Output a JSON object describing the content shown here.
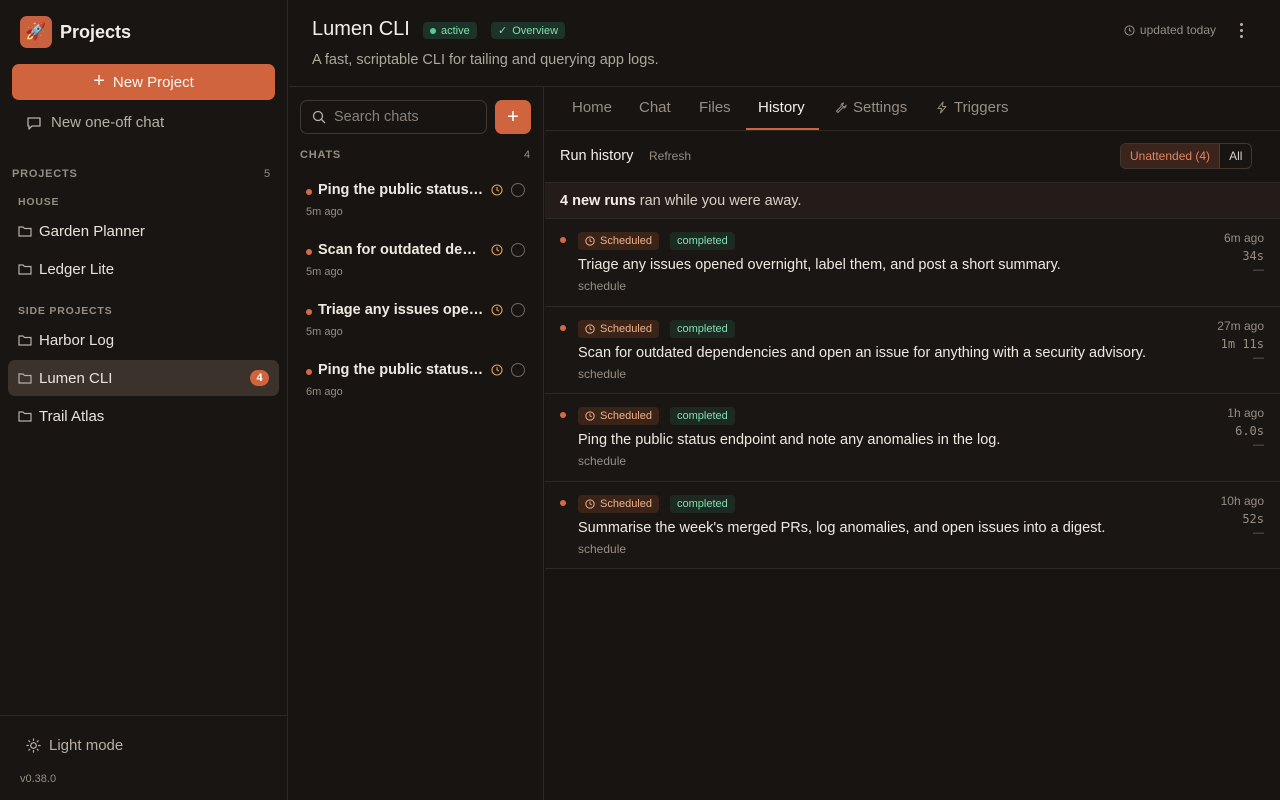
{
  "sidebar": {
    "title": "Projects",
    "new_project_label": "New Project",
    "new_chat_label": "New one-off chat",
    "projects_label": "PROJECTS",
    "projects_count": "5",
    "groups": [
      {
        "label": "HOUSE",
        "items": [
          "Garden Planner",
          "Ledger Lite"
        ]
      },
      {
        "label": "SIDE PROJECTS",
        "items": [
          "Harbor Log",
          "Lumen CLI",
          "Trail Atlas"
        ]
      }
    ],
    "active_project_badge": "4",
    "light_mode_label": "Light mode",
    "version": "v0.38.0"
  },
  "header": {
    "title": "Lumen CLI",
    "status": "active",
    "overview_label": "Overview",
    "subtitle": "A fast, scriptable CLI for tailing and querying app logs.",
    "updated": "updated today"
  },
  "chats": {
    "search_placeholder": "Search chats",
    "label": "CHATS",
    "count": "4",
    "items": [
      {
        "title": "Ping the public status endpoint and note any anomalies in the log.",
        "time": "5m ago"
      },
      {
        "title": "Scan for outdated dependencies and open an issue for anything with a security advisory.",
        "time": "5m ago"
      },
      {
        "title": "Triage any issues opened overnight, label them, and post a short summary.",
        "time": "5m ago"
      },
      {
        "title": "Ping the public status endpoint and note any anomalies in the log.",
        "time": "6m ago"
      }
    ]
  },
  "tabs": {
    "home": "Home",
    "chat": "Chat",
    "files": "Files",
    "history": "History",
    "settings": "Settings",
    "triggers": "Triggers"
  },
  "history": {
    "title": "Run history",
    "refresh_label": "Refresh",
    "unattended_label": "Unattended (4)",
    "all_label": "All",
    "banner_bold": "4 new runs",
    "banner_rest": "ran while you were away.",
    "runs": [
      {
        "trigger": "Scheduled",
        "status": "completed",
        "text": "Triage any issues opened overnight, label them, and post a short summary.",
        "source": "schedule",
        "ago": "6m ago",
        "duration": "34s",
        "extra": "—"
      },
      {
        "trigger": "Scheduled",
        "status": "completed",
        "text": "Scan for outdated dependencies and open an issue for anything with a security advisory.",
        "source": "schedule",
        "ago": "27m ago",
        "duration": "1m 11s",
        "extra": "—"
      },
      {
        "trigger": "Scheduled",
        "status": "completed",
        "text": "Ping the public status endpoint and note any anomalies in the log.",
        "source": "schedule",
        "ago": "1h ago",
        "duration": "6.0s",
        "extra": "—"
      },
      {
        "trigger": "Scheduled",
        "status": "completed",
        "text": "Summarise the week's merged PRs, log anomalies, and open issues into a digest.",
        "source": "schedule",
        "ago": "10h ago",
        "duration": "52s",
        "extra": "—"
      }
    ]
  },
  "colors": {
    "accent": "#d0643f",
    "background": "#171412",
    "success": "#7fe0b0"
  },
  "icons": {
    "brand": "rocket-icon",
    "folder": "folder-icon",
    "chat": "chat-bubble-icon",
    "sun": "sun-icon",
    "clock": "clock-icon",
    "search": "search-icon",
    "wrench": "wrench-icon",
    "bolt": "bolt-icon"
  }
}
